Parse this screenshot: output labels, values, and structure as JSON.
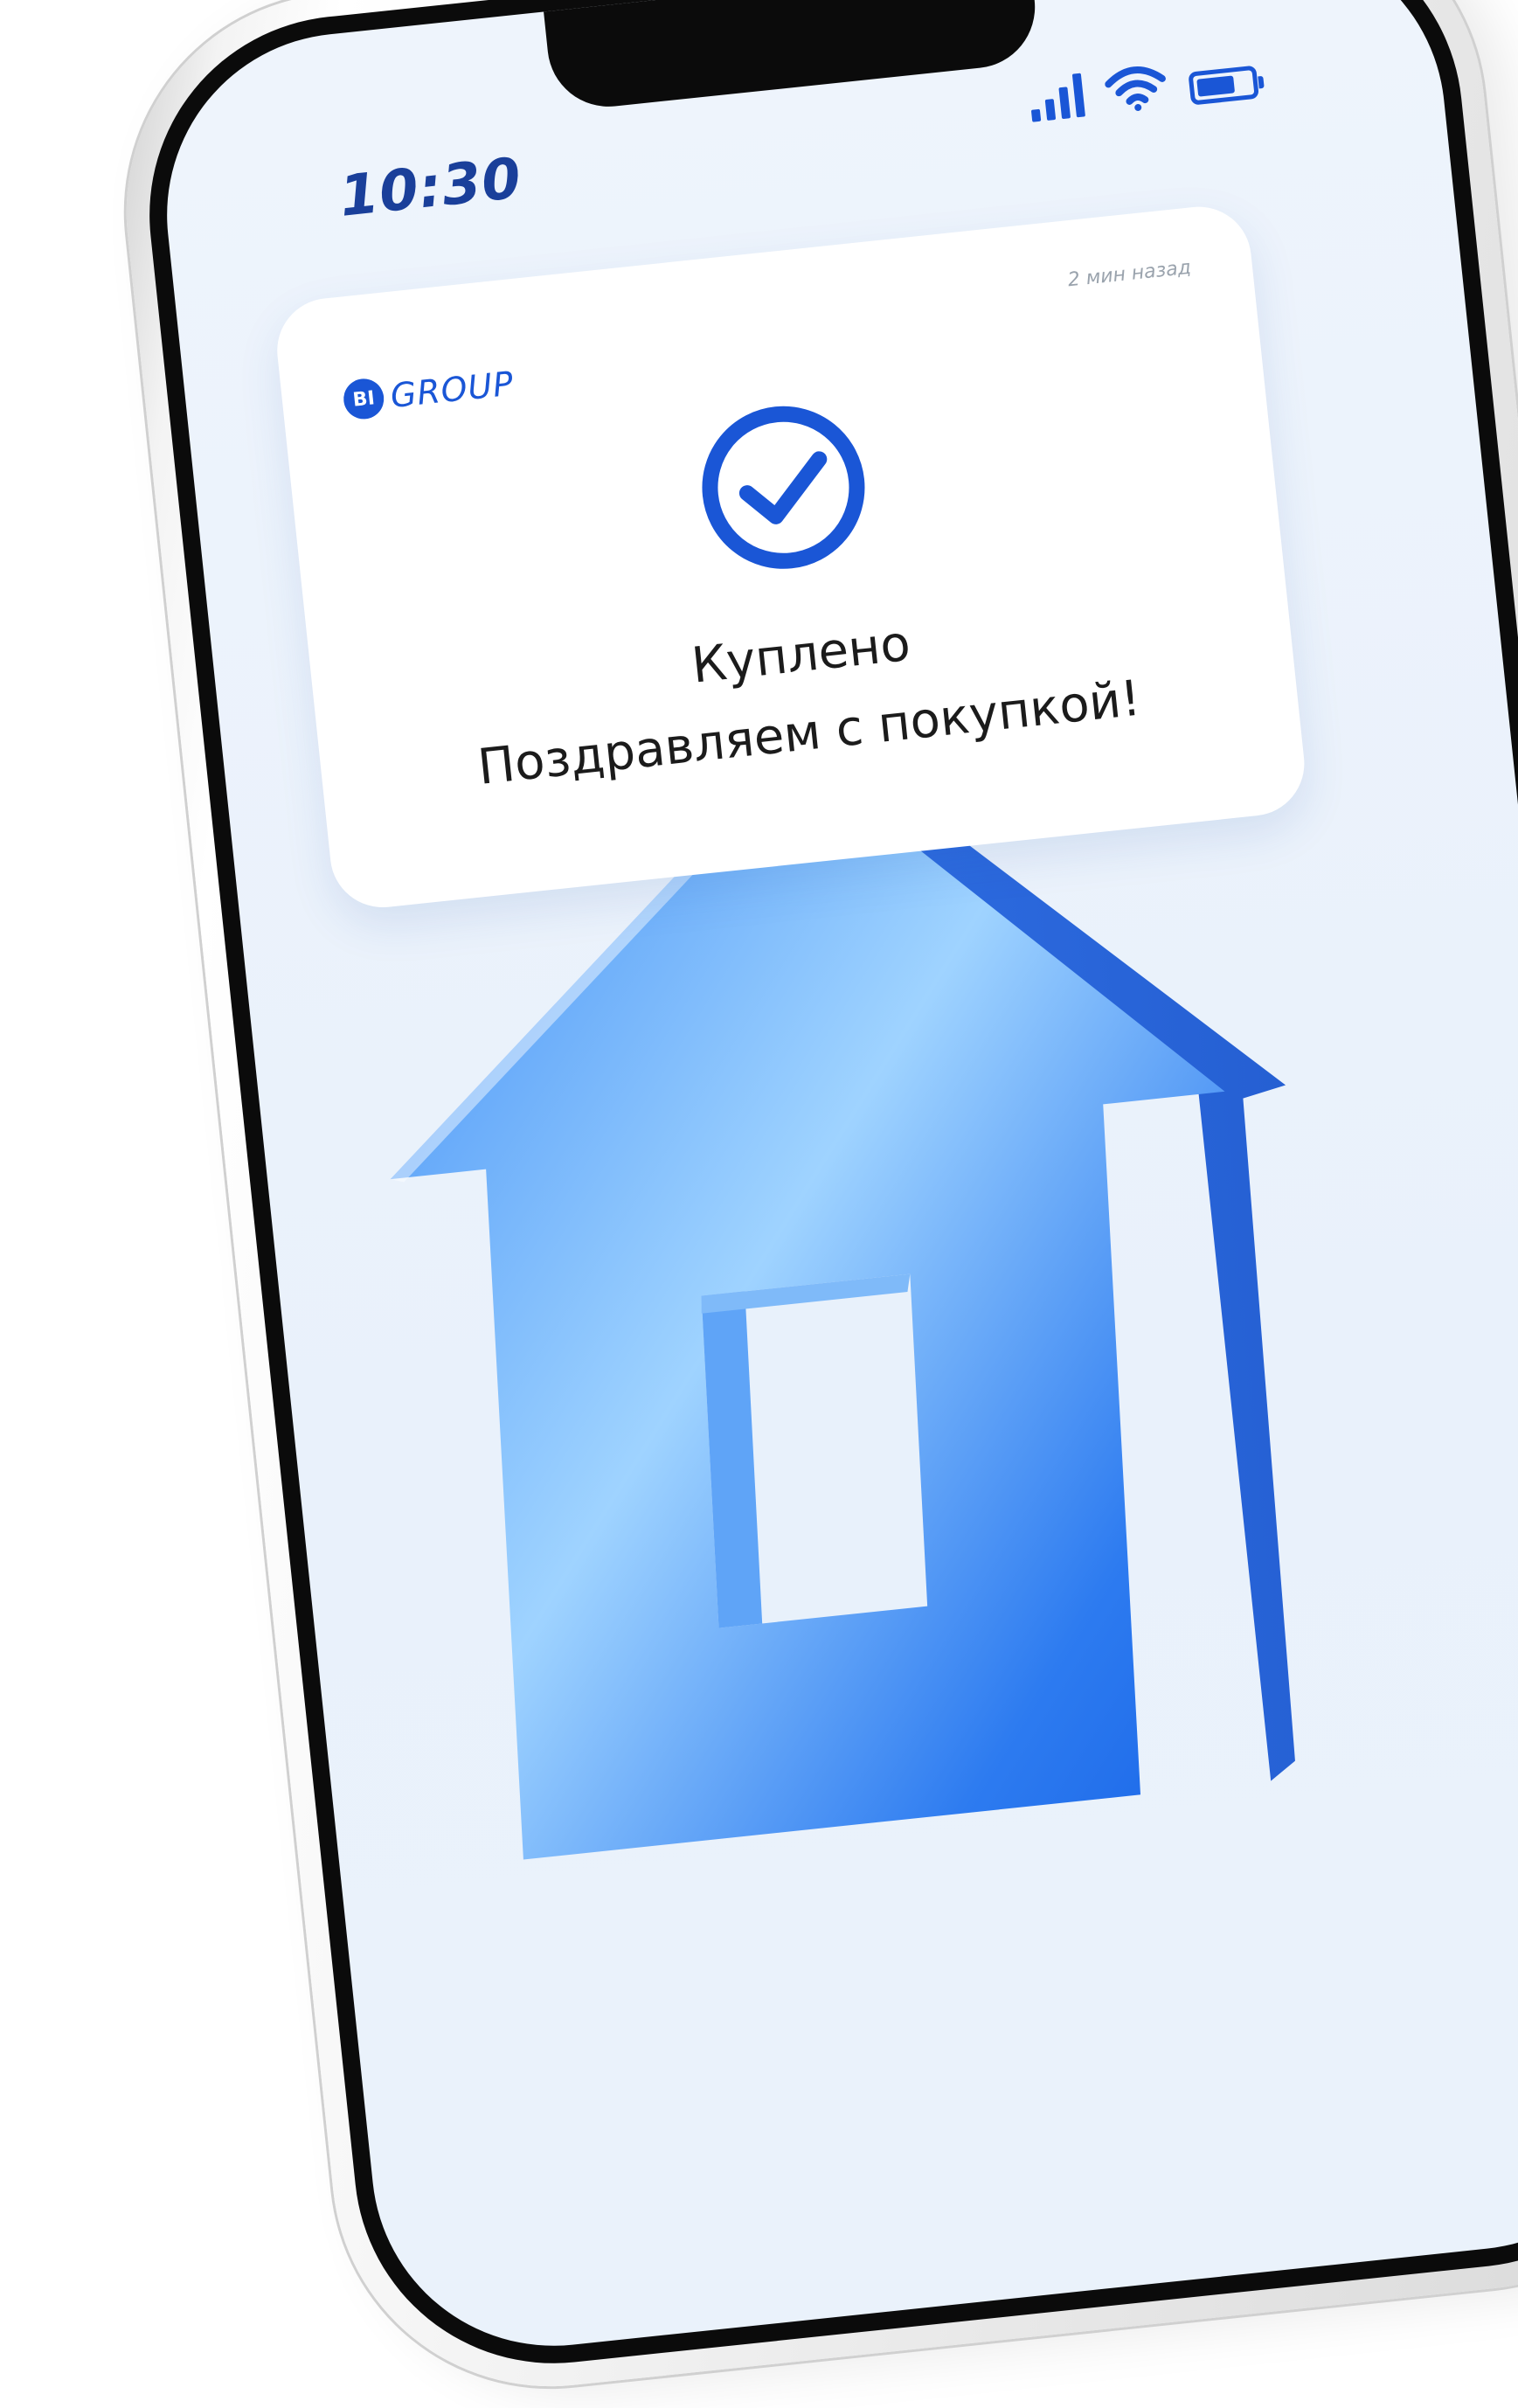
{
  "status_bar": {
    "time": "10:30",
    "signal_icon": "cellular-signal-icon",
    "wifi_icon": "wifi-icon",
    "battery_icon": "battery-icon",
    "battery_level": 0.7
  },
  "notification": {
    "brand": {
      "badge": "BI",
      "name": "GROUP"
    },
    "timestamp": "2 мин назад",
    "icon": "checkmark-circle-icon",
    "title": "Куплено",
    "message": "Поздравляем с покупкой!"
  },
  "illustration": {
    "icon": "house-icon"
  },
  "colors": {
    "accent": "#1a56d6",
    "time_text": "#1a3f9a",
    "screen_bg": "#eef4fc",
    "card_bg": "#ffffff"
  }
}
